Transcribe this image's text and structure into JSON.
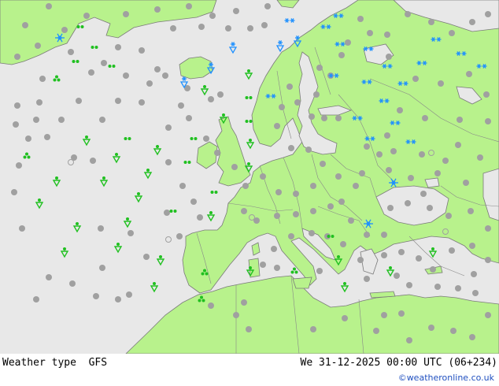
{
  "footer": {
    "title": "Weather type  GFS",
    "datetime": "We 31-12-2025 00:00 UTC (06+234)",
    "credit": "©weatheronline.co.uk"
  },
  "colors": {
    "sea": "#e8e8e8",
    "land": "#b8f28c",
    "border": "#888888",
    "coast": "#7a7a7a",
    "rain": "#20c020",
    "snow": "#1e90ff",
    "cloud": "#a0a0a0"
  },
  "icons": {
    "cloud": "cloud-dot-icon",
    "clear": "clear-circle-icon",
    "rain": "rain-shower-icon",
    "drizzle": "drizzle-icon",
    "showers": "showers-cluster-icon",
    "snow": "snowflake-icon",
    "snow_shower": "snow-shower-icon",
    "heavy_snow": "heavy-snow-icon"
  }
}
